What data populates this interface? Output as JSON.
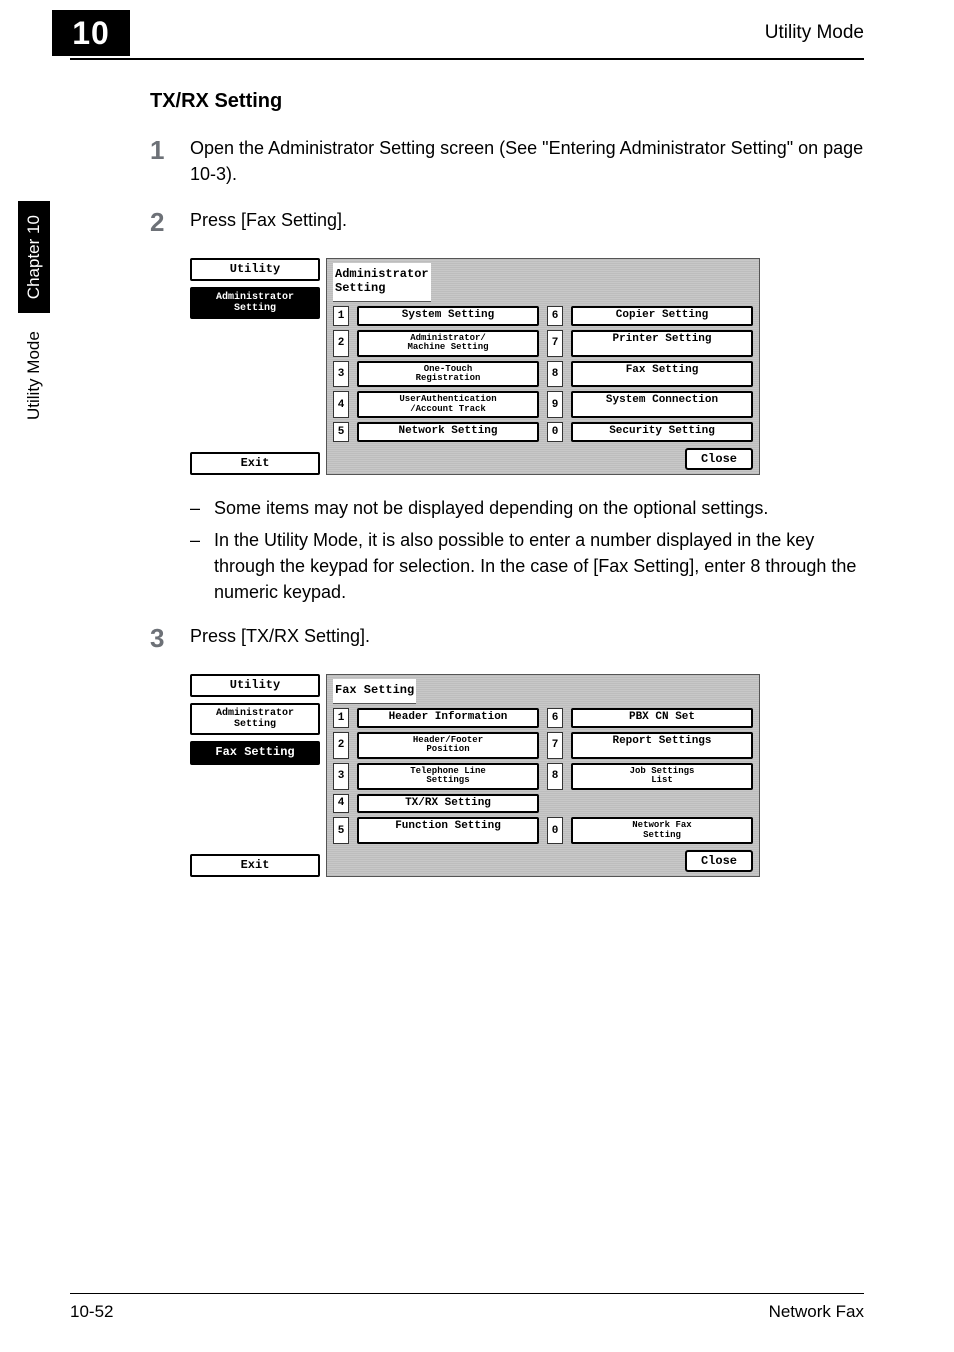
{
  "header": {
    "chapter_number": "10",
    "right_title": "Utility Mode"
  },
  "sidebar": {
    "mode_label": "Utility Mode",
    "chapter_label": "Chapter 10"
  },
  "section": {
    "title": "TX/RX Setting"
  },
  "steps": {
    "s1": {
      "num": "1",
      "text": "Open the Administrator Setting screen (See \"Entering Administrator Setting\" on page 10-3)."
    },
    "s2": {
      "num": "2",
      "text": "Press [Fax Setting]."
    },
    "s3": {
      "num": "3",
      "text": "Press [TX/RX Setting]."
    }
  },
  "notes": {
    "n1": "Some items may not be displayed depending on the optional settings.",
    "n2": "In the Utility Mode, it is also possible to enter a number displayed in the key through the keypad for selection. In the case of [Fax Setting], enter 8 through the numeric keypad."
  },
  "lcd1": {
    "utility_btn": "Utility",
    "admin_btn": "Administrator\nSetting",
    "exit_btn": "Exit",
    "title": "Administrator\nSetting",
    "items_left": [
      {
        "n": "1",
        "label": "System Setting"
      },
      {
        "n": "2",
        "label": "Administrator/\nMachine Setting"
      },
      {
        "n": "3",
        "label": "One-Touch\nRegistration"
      },
      {
        "n": "4",
        "label": "UserAuthentication\n/Account Track"
      },
      {
        "n": "5",
        "label": "Network Setting"
      }
    ],
    "items_right": [
      {
        "n": "6",
        "label": "Copier Setting"
      },
      {
        "n": "7",
        "label": "Printer Setting"
      },
      {
        "n": "8",
        "label": "Fax Setting"
      },
      {
        "n": "9",
        "label": "System Connection"
      },
      {
        "n": "0",
        "label": "Security Setting"
      }
    ],
    "close": "Close"
  },
  "lcd2": {
    "utility_btn": "Utility",
    "admin_btn": "Administrator\nSetting",
    "fax_btn": "Fax Setting",
    "exit_btn": "Exit",
    "title": "Fax Setting",
    "items_left": [
      {
        "n": "1",
        "label": "Header Information"
      },
      {
        "n": "2",
        "label": "Header/Footer\nPosition"
      },
      {
        "n": "3",
        "label": "Telephone Line\nSettings"
      },
      {
        "n": "4",
        "label": "TX/RX Setting"
      },
      {
        "n": "5",
        "label": "Function Setting"
      }
    ],
    "items_right": [
      {
        "n": "6",
        "label": "PBX CN Set"
      },
      {
        "n": "7",
        "label": "Report Settings"
      },
      {
        "n": "8",
        "label": "Job Settings\nList"
      },
      {
        "n": "",
        "label": ""
      },
      {
        "n": "0",
        "label": "Network Fax\nSetting"
      }
    ],
    "close": "Close"
  },
  "footer": {
    "left": "10-52",
    "right": "Network Fax"
  }
}
